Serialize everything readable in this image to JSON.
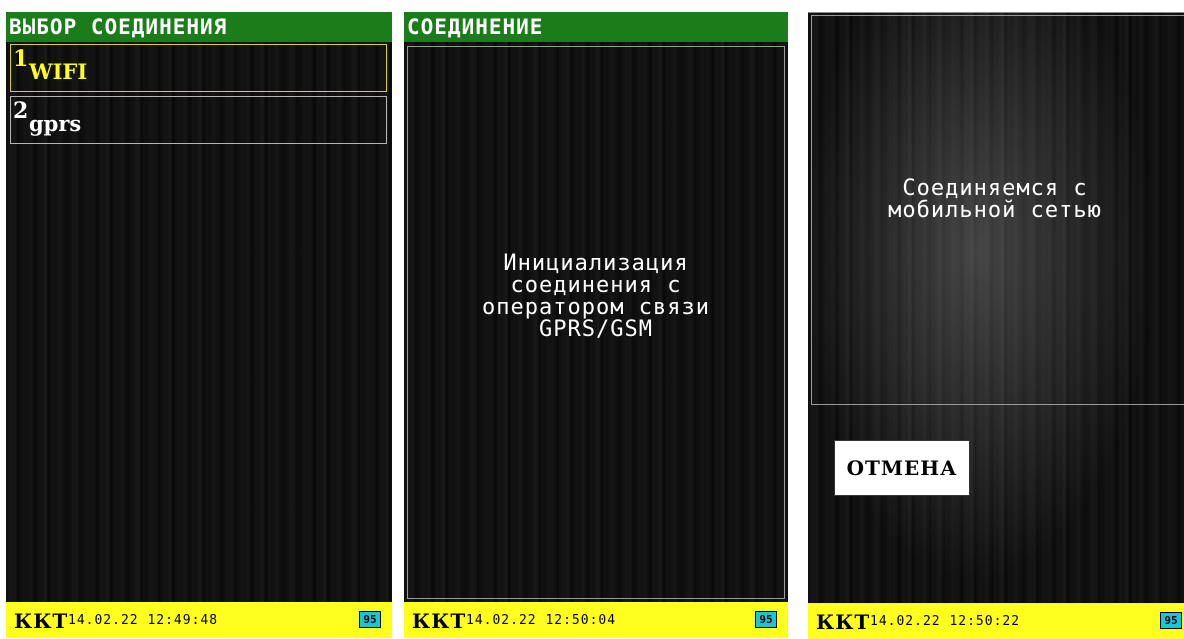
{
  "screen1": {
    "header": "ВЫБОР СОЕДИНЕНИЯ",
    "items": [
      {
        "num": "1",
        "label": "WIFI"
      },
      {
        "num": "2",
        "label": "gprs"
      }
    ],
    "status": {
      "kkt": "ККТ",
      "datetime": "14.02.22 12:49:48",
      "badge": "95"
    }
  },
  "screen2": {
    "header": "СОЕДИНЕНИЕ",
    "message": [
      "Инициализация",
      "соединения с",
      "оператором связи",
      "GPRS/GSM"
    ],
    "status": {
      "kkt": "ККТ",
      "datetime": "14.02.22 12:50:04",
      "badge": "95"
    }
  },
  "screen3": {
    "message": [
      "Соединяемся с",
      "мобильной сетью"
    ],
    "cancel_label": "ОТМЕНА",
    "status": {
      "kkt": "ККТ",
      "datetime": "14.02.22 12:50:22",
      "badge": "95"
    }
  },
  "colors": {
    "header_bg": "#1a7d1a",
    "statusbar_bg": "#ffff1e",
    "selected_text": "#ffff1a",
    "badge_bg": "#18c6d6"
  }
}
